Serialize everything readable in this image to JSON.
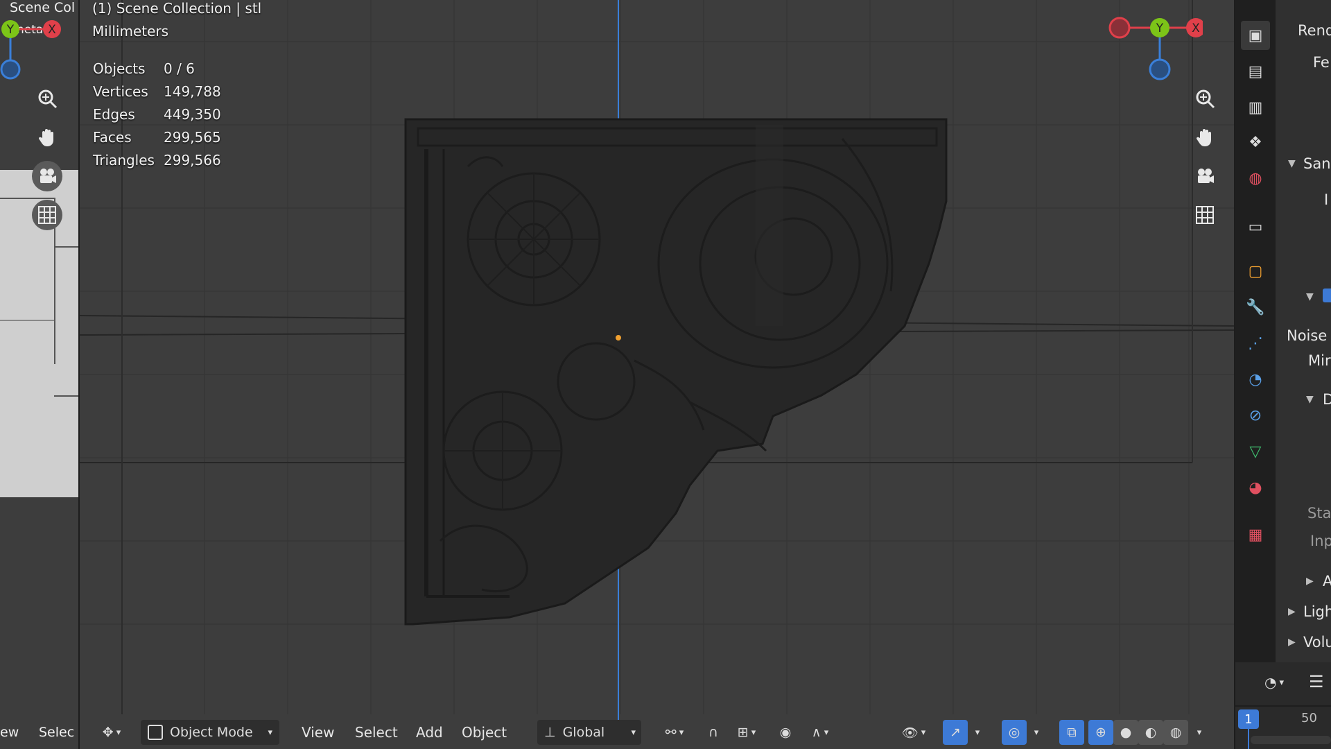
{
  "left_view": {
    "header_text": "Scene Col",
    "sub_text": "neta",
    "header_items": [
      "ew",
      "Selec"
    ]
  },
  "viewport": {
    "collection_label": "(1) Scene Collection | stl",
    "units_label": "Millimeters",
    "stats": [
      {
        "label": "Objects",
        "value": "0 / 6"
      },
      {
        "label": "Vertices",
        "value": "149,788"
      },
      {
        "label": "Edges",
        "value": "449,350"
      },
      {
        "label": "Faces",
        "value": "299,565"
      },
      {
        "label": "Triangles",
        "value": "299,566"
      }
    ],
    "gizmo": {
      "y_label": "Y",
      "x_label": "X"
    },
    "nav_icons": [
      "zoom-icon",
      "hand-pan-icon",
      "camera-icon",
      "grid-icon"
    ]
  },
  "header": {
    "mode": "Object Mode",
    "menus": [
      "View",
      "Select",
      "Add",
      "Object"
    ],
    "orientation": "Global"
  },
  "properties": {
    "partial_labels": [
      "Rend",
      "Fe",
      "San",
      "I",
      "Noise T",
      "Mir",
      "D",
      "Star",
      "Inp",
      "A",
      "Ligh",
      "Volu"
    ]
  },
  "timeline": {
    "current_frame": "1",
    "end_frame": "50"
  },
  "colors": {
    "axis_x": "#e0404a",
    "axis_y": "#7cc418",
    "axis_z": "#3a7fd9",
    "viewport_bg": "#3d3d3d",
    "panel_bg": "#303030",
    "accent": "#3d7ad6"
  }
}
